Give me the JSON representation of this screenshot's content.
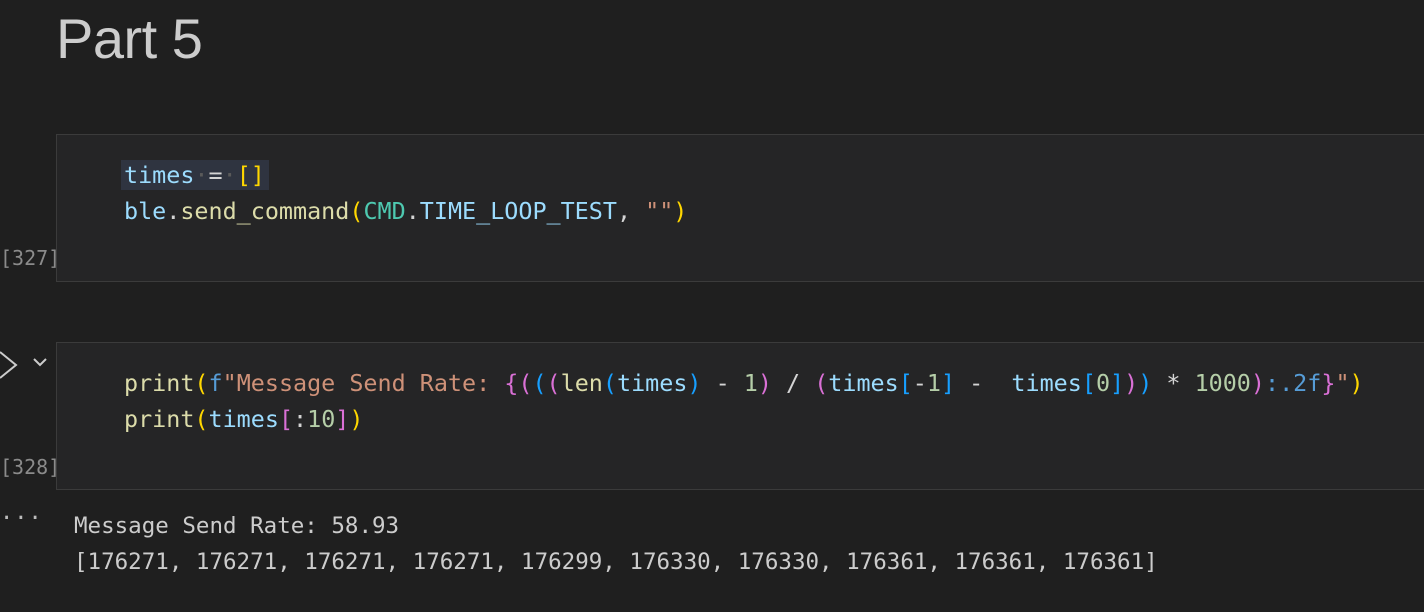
{
  "heading": "Part 5",
  "cells": [
    {
      "execution_count": "[327]",
      "code_lines": [
        "times = []",
        "ble.send_command(CMD.TIME_LOOP_TEST, \"\")"
      ]
    },
    {
      "execution_count": "[328]",
      "code_lines": [
        "print(f\"Message Send Rate: {(((len(times) - 1) / (times[-1] -  times[0])) * 1000):.2f}\")",
        "print(times[:10])"
      ],
      "output_lines": [
        "Message Send Rate: 58.93",
        "[176271, 176271, 176271, 176271, 176299, 176330, 176330, 176361, 176361, 176361]"
      ]
    }
  ],
  "icons": {
    "run": "run-icon",
    "collapse": "chevron-down-icon",
    "output_menu": "ellipsis-icon"
  },
  "colors": {
    "background": "#1f1f1f",
    "cell_background": "#252526",
    "variable": "#9cdcfe",
    "function": "#dcdcaa",
    "class": "#4ec9b0",
    "string": "#ce9178",
    "number": "#b5cea8"
  }
}
